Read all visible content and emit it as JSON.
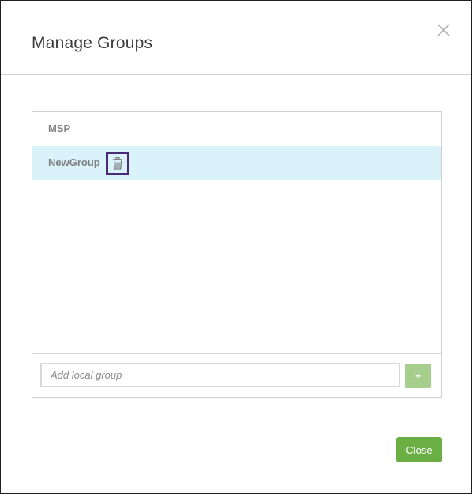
{
  "dialog": {
    "title": "Manage Groups",
    "close_icon": "close-x-icon"
  },
  "groups": [
    {
      "label": "MSP",
      "selected": false
    },
    {
      "label": "NewGroup",
      "selected": true,
      "action_icon": "trash-icon"
    }
  ],
  "add_group": {
    "placeholder": "Add local group",
    "value": "",
    "button_label": "+"
  },
  "footer": {
    "close_label": "Close"
  },
  "colors": {
    "selected_row": "#daf3fb",
    "highlight_border": "#4b2a78",
    "primary_button": "#6aae44",
    "disabled_add_button": "#a6cf8e",
    "title_text": "#3a3a3a",
    "group_text": "#808080"
  }
}
